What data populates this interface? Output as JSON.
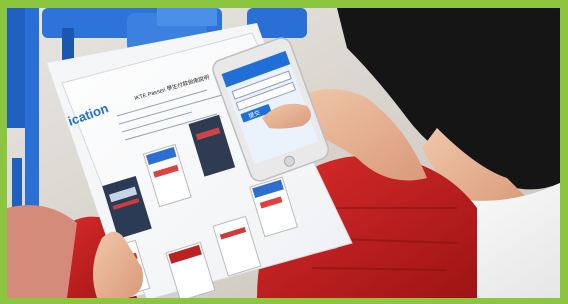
{
  "image": {
    "kind": "photo",
    "border_color": "#8cc63f",
    "scene": "person-reading-printed-guide-with-smartphone"
  },
  "document": {
    "side_label": "ication",
    "title": "IKTE Passeri 學生付款指南說明"
  },
  "phone": {
    "button_label": "提交"
  }
}
